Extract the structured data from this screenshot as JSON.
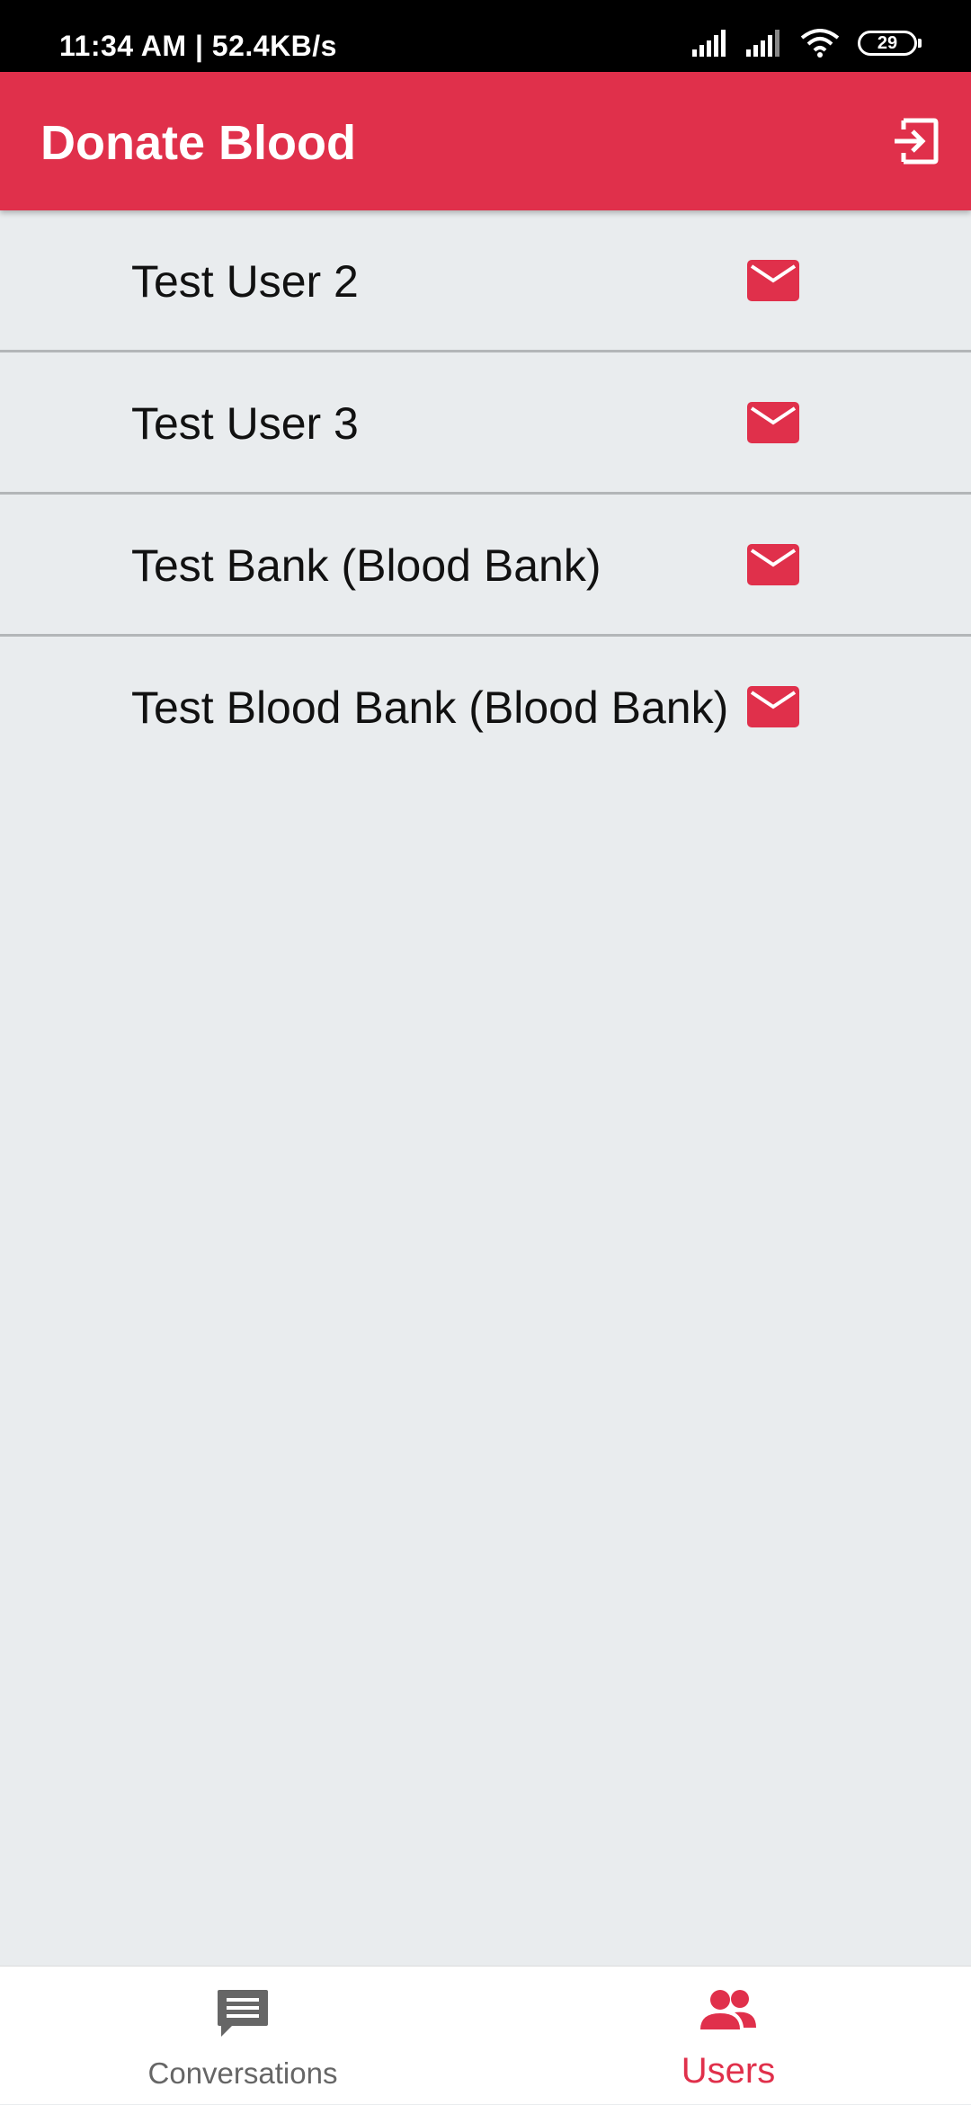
{
  "status_bar": {
    "time": "11:34 AM | 52.4KB/s",
    "battery": "29",
    "icons": [
      "signal-icon",
      "signal-icon",
      "wifi-icon",
      "battery-icon"
    ]
  },
  "app_bar": {
    "title": "Donate Blood",
    "action_icon": "logout-icon"
  },
  "users": [
    {
      "name": "Test User 2",
      "action_icon": "mail-icon"
    },
    {
      "name": "Test User 3",
      "action_icon": "mail-icon"
    },
    {
      "name": "Test Bank (Blood Bank)",
      "action_icon": "mail-icon"
    },
    {
      "name": "Test Blood Bank (Blood Bank)",
      "action_icon": "mail-icon"
    }
  ],
  "bottom_nav": {
    "items": [
      {
        "label": "Conversations",
        "icon": "chat-icon",
        "active": false
      },
      {
        "label": "Users",
        "icon": "users-icon",
        "active": true
      }
    ]
  },
  "colors": {
    "accent": "#e0304b",
    "background": "#e9ecee",
    "status_bar": "#000000",
    "nav_inactive": "#666666"
  }
}
